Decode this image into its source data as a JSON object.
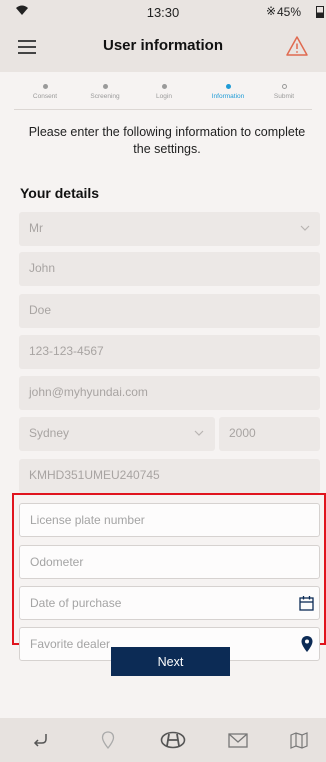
{
  "status_bar": {
    "time": "13:30",
    "battery": "45%"
  },
  "header": {
    "title": "User information",
    "menu_icon": "hamburger-menu-icon",
    "alert_icon": "warning-triangle-icon"
  },
  "steps": [
    {
      "label": "Consent",
      "state": "done"
    },
    {
      "label": "Screening",
      "state": "done"
    },
    {
      "label": "Login",
      "state": "done"
    },
    {
      "label": "Information",
      "state": "active"
    },
    {
      "label": "Submit",
      "state": "pending"
    }
  ],
  "instructions": "Please enter the following information to complete the settings.",
  "section_title": "Your details",
  "fields": {
    "title": "Mr",
    "first_name": "John",
    "last_name": "Doe",
    "phone": "123-123-4567",
    "email": "john@myhyundai.com",
    "city": "Sydney",
    "postcode": "2000",
    "vin": "KMHD351UMEU240745"
  },
  "placeholders": {
    "license_plate": "License plate number",
    "odometer": "Odometer",
    "date_of_purchase": "Date of purchase",
    "favorite_dealer": "Favorite dealer"
  },
  "next_label": "Next",
  "colors": {
    "primary": "#0c2b55",
    "accent": "#1f9bd6",
    "highlight": "#e0141e",
    "warning": "#e06a50"
  },
  "bottom_nav": [
    "back-arrow-icon",
    "location-pin-icon",
    "hyundai-logo-icon",
    "mail-icon",
    "map-icon"
  ]
}
